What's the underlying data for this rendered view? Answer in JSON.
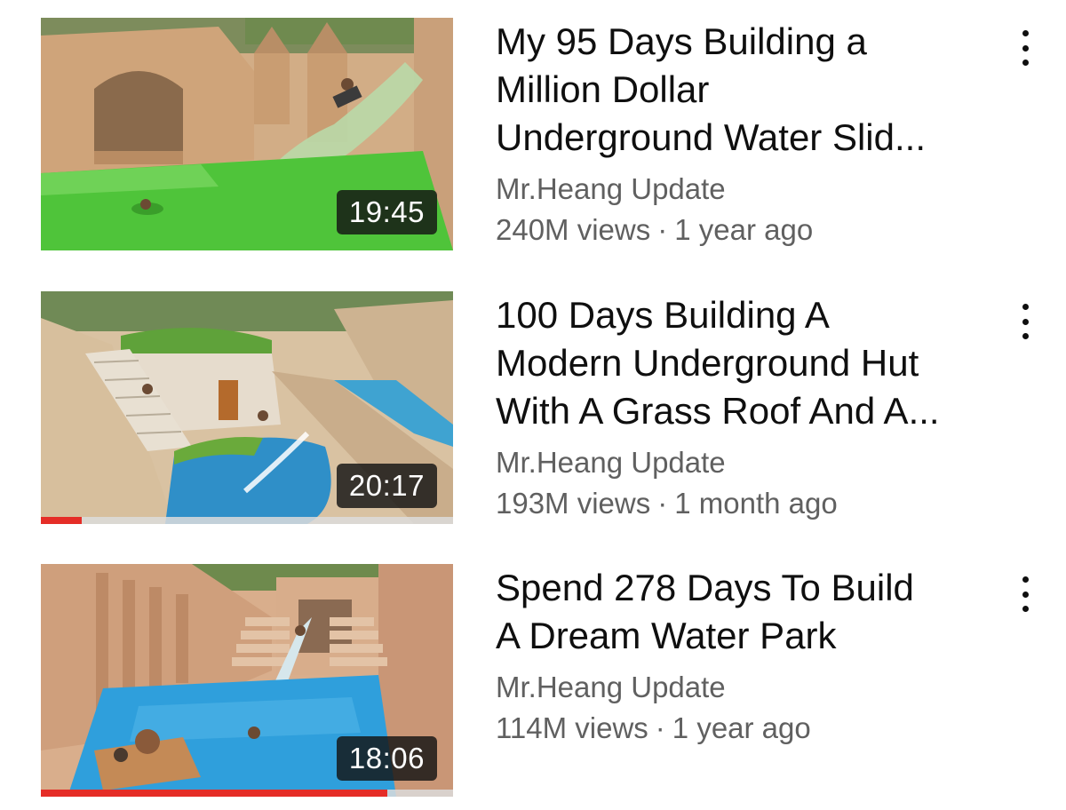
{
  "videos": [
    {
      "title_lines": [
        "My 95 Days Building a",
        "Million Dollar",
        "Underground Water Slid..."
      ],
      "channel": "Mr.Heang Update",
      "views": "240M views",
      "age": "1 year ago",
      "duration": "19:45",
      "watch_progress": 0
    },
    {
      "title_lines": [
        "100 Days Building A",
        "Modern Underground Hut",
        "With A Grass Roof And A..."
      ],
      "channel": "Mr.Heang Update",
      "views": "193M views",
      "age": "1 month ago",
      "duration": "20:17",
      "watch_progress": 0.1
    },
    {
      "title_lines": [
        "Spend 278 Days To Build",
        "A Dream Water Park"
      ],
      "channel": "Mr.Heang Update",
      "views": "114M views",
      "age": "1 year ago",
      "duration": "18:06",
      "watch_progress": 0.84
    }
  ],
  "meta_separator": "·",
  "colors": {
    "progress": "#e52d27",
    "title": "#0f0f0f",
    "secondary": "#606060"
  }
}
